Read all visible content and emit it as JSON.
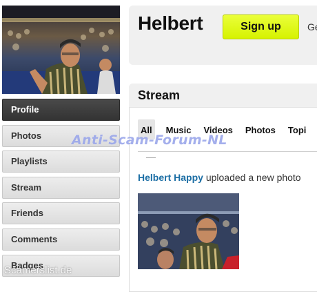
{
  "profile": {
    "username": "Helbert",
    "signup_label": "Sign up",
    "header_extra_text": "Ge"
  },
  "sidebar": {
    "items": [
      {
        "label": "Profile",
        "active": true
      },
      {
        "label": "Photos"
      },
      {
        "label": "Playlists"
      },
      {
        "label": "Stream"
      },
      {
        "label": "Friends"
      },
      {
        "label": "Comments"
      },
      {
        "label": "Badges"
      }
    ]
  },
  "stream": {
    "title": "Stream",
    "tabs": [
      {
        "label": "All",
        "active": true
      },
      {
        "label": "Music"
      },
      {
        "label": "Videos"
      },
      {
        "label": "Photos"
      },
      {
        "label": "Topi"
      }
    ],
    "post": {
      "user": "Helbert Happy",
      "action": "uploaded a new photo"
    }
  },
  "watermarks": {
    "center": "Anti-Scam-Forum-NL",
    "bottom": "Scamerslist.de"
  },
  "colors": {
    "signup_bg": "#e0f712",
    "link_blue": "#1d6fa5",
    "active_nav": "#3d3d3d",
    "watermark_blue": "#6a7ee0"
  }
}
